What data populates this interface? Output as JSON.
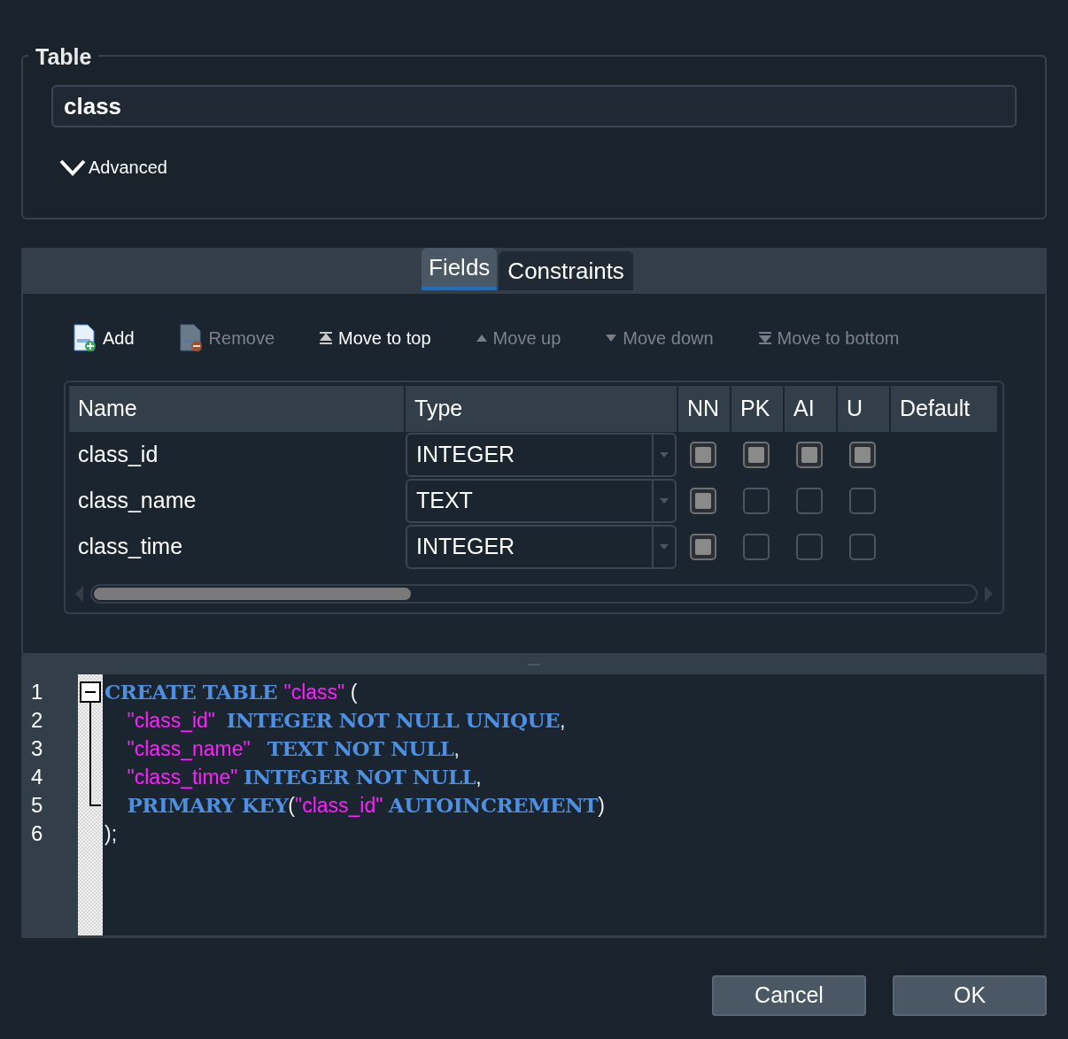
{
  "table_group": {
    "title": "Table",
    "name_value": "class",
    "advanced": {
      "label": "Advanced"
    }
  },
  "tabs": [
    {
      "label": "Fields",
      "selected": true
    },
    {
      "label": "Constraints",
      "selected": false
    }
  ],
  "toolbar": [
    {
      "kind": "add",
      "label": "Add",
      "disabled": false
    },
    {
      "kind": "remove",
      "label": "Remove",
      "disabled": true
    },
    {
      "kind": "top",
      "label": "Move to top",
      "disabled": false
    },
    {
      "kind": "up",
      "label": "Move up",
      "disabled": true
    },
    {
      "kind": "down",
      "label": "Move down",
      "disabled": true
    },
    {
      "kind": "bottom",
      "label": "Move to bottom",
      "disabled": true
    }
  ],
  "fields_table": {
    "columns": [
      "Name",
      "Type",
      "NN",
      "PK",
      "AI",
      "U",
      "Default"
    ],
    "rows": [
      {
        "name": "class_id",
        "type": "INTEGER",
        "nn": true,
        "pk": true,
        "ai": true,
        "u": true
      },
      {
        "name": "class_name",
        "type": "TEXT",
        "nn": true,
        "pk": false,
        "ai": false,
        "u": false
      },
      {
        "name": "class_time",
        "type": "INTEGER",
        "nn": true,
        "pk": false,
        "ai": false,
        "u": false
      }
    ]
  },
  "sql_editor": {
    "lines": [
      {
        "number": "1",
        "tokens": [
          {
            "kind": "keyword",
            "text": "CREATE TABLE "
          },
          {
            "kind": "string",
            "text": "\"class\""
          },
          {
            "kind": "plain",
            "text": " ("
          }
        ]
      },
      {
        "number": "2",
        "tokens": [
          {
            "kind": "string",
            "text": "\t\"class_id\"  "
          },
          {
            "kind": "keyword",
            "text": "INTEGER NOT NULL UNIQUE"
          },
          {
            "kind": "plain",
            "text": ","
          }
        ]
      },
      {
        "number": "3",
        "tokens": [
          {
            "kind": "string",
            "text": "\t\"class_name\"   "
          },
          {
            "kind": "keyword",
            "text": "TEXT NOT NULL"
          },
          {
            "kind": "plain",
            "text": ","
          }
        ]
      },
      {
        "number": "4",
        "tokens": [
          {
            "kind": "string",
            "text": "\t\"class_time\" "
          },
          {
            "kind": "keyword",
            "text": "INTEGER NOT NULL"
          },
          {
            "kind": "plain",
            "text": ","
          }
        ]
      },
      {
        "number": "5",
        "tokens": [
          {
            "kind": "keyword",
            "text": "\tPRIMARY KEY"
          },
          {
            "kind": "plain",
            "text": "("
          },
          {
            "kind": "string",
            "text": "\"class_id\" "
          },
          {
            "kind": "keyword",
            "text": "AUTOINCREMENT"
          },
          {
            "kind": "plain",
            "text": ")"
          }
        ]
      },
      {
        "number": "6",
        "tokens": [
          {
            "kind": "plain",
            "text": ");"
          }
        ]
      }
    ]
  },
  "buttons": [
    {
      "label": "Cancel"
    },
    {
      "label": "OK"
    }
  ]
}
